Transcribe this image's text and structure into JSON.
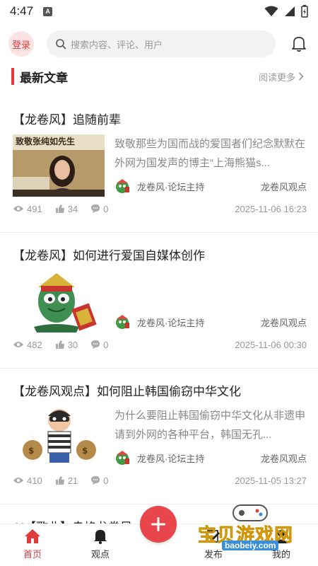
{
  "status": {
    "time": "4:47",
    "app_icon_letter": "A"
  },
  "header": {
    "login_label": "登录",
    "search_placeholder": "搜索内容、评论、用户"
  },
  "section": {
    "title": "最新文章",
    "read_more": "阅读更多"
  },
  "articles": [
    {
      "title": "【龙卷风】追随前辈",
      "thumb_caption": "致敬张纯如先生",
      "summary": "致敬那些为国而战的爱国者们纪念默默在外网为国发声的博主“上海熊猫s...",
      "author": "龙卷风·论坛主持",
      "tag": "龙卷风观点",
      "views": "491",
      "likes": "34",
      "comments": "0",
      "date": "2025-11-06 16:23"
    },
    {
      "title": "【龙卷风】如何进行爱国自媒体创作",
      "summary": "",
      "author": "龙卷风·论坛主持",
      "tag": "龙卷风观点",
      "views": "482",
      "likes": "30",
      "comments": "0",
      "date": "2025-11-06 00:30"
    },
    {
      "title": "【龙卷风观点】如何阻止韩国偷窃中华文化",
      "summary": "为什么要阻止韩国偷窃中华文化从非遗申请到外网的各种平台，韩国无孔...",
      "author": "龙卷风·论坛主持",
      "tag": "龙卷风观点",
      "views": "410",
      "likes": "21",
      "comments": "0",
      "date": "2025-11-05 13:27"
    },
    {
      "title": "AI【歌曲】赤焰龙卷风"
    }
  ],
  "nav": {
    "home": "首页",
    "opinion": "观点",
    "publish": "发布",
    "mine": "我的"
  },
  "watermark": {
    "text": "宝贝游戏网",
    "url": "baobeiy.com"
  },
  "colors": {
    "accent": "#e03c3c",
    "add_button": "#e8464a",
    "muted": "#999999"
  }
}
